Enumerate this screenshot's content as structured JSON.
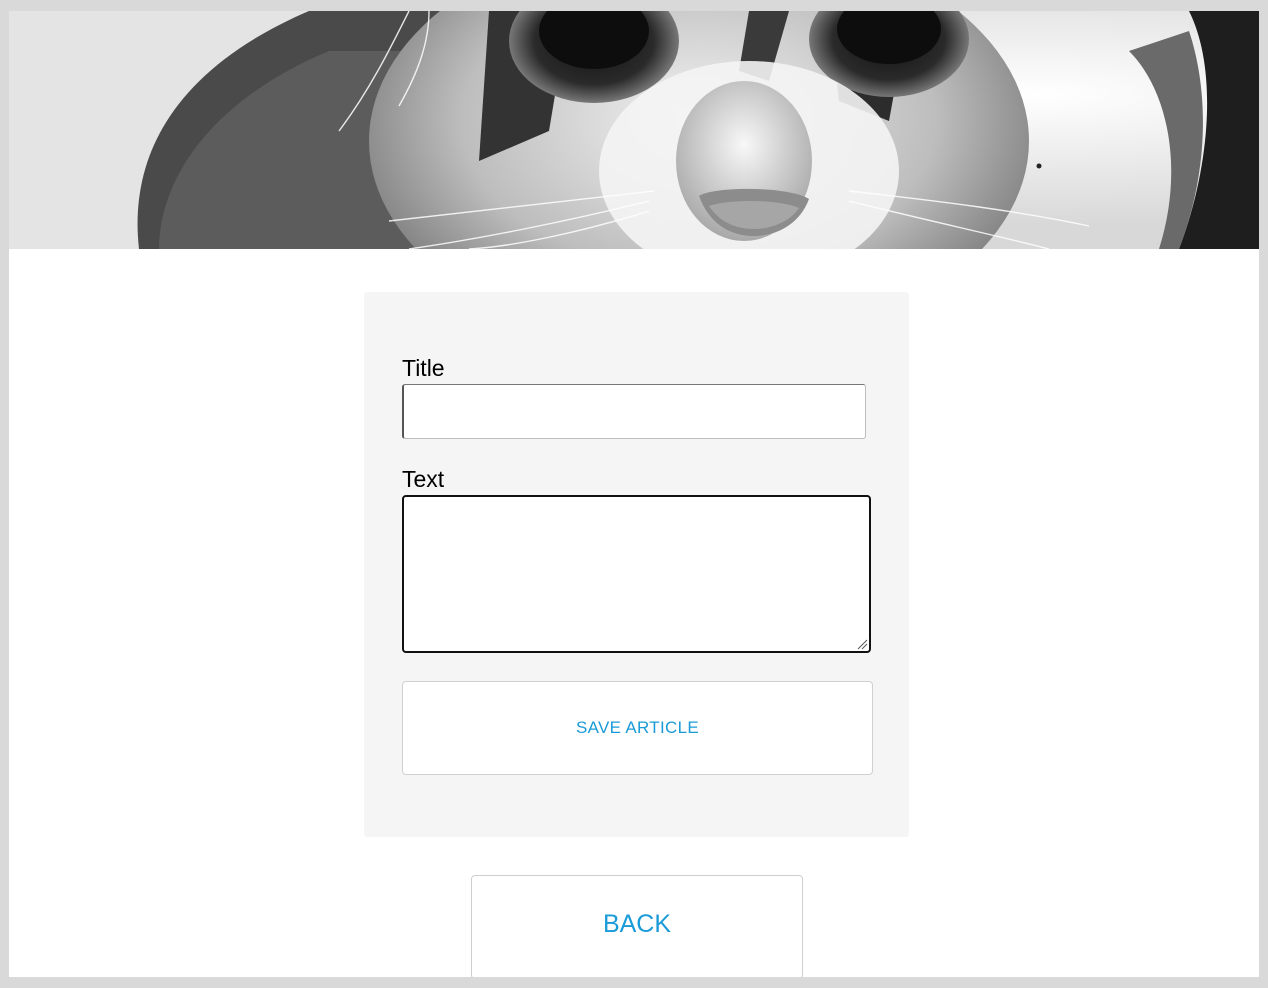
{
  "hero": {
    "image_icon": "kitten-photo"
  },
  "form": {
    "title_label": "Title",
    "title_value": "",
    "text_label": "Text",
    "text_value": "",
    "save_label": "SAVE ARTICLE"
  },
  "navigation": {
    "back_label": "BACK"
  },
  "colors": {
    "accent": "#1a9bd7",
    "card_background": "#f5f5f5",
    "frame_background": "#d9d9d9"
  }
}
